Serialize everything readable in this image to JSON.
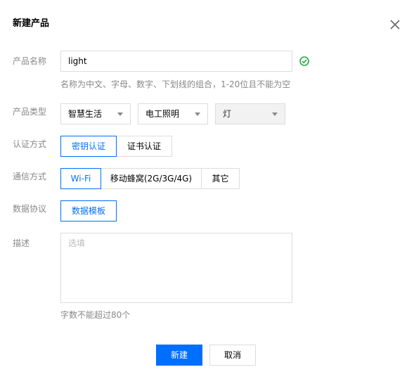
{
  "dialog": {
    "title": "新建产品",
    "close_icon": "close-icon"
  },
  "product_name": {
    "label": "产品名称",
    "value": "light",
    "status_icon": "check-circle-icon",
    "status_color": "#27a844",
    "hint": "名称为中文、字母、数字、下划线的组合，1-20位且不能为空"
  },
  "product_type": {
    "label": "产品类型",
    "selects": [
      "智慧生活",
      "电工照明",
      "灯"
    ]
  },
  "auth": {
    "label": "认证方式",
    "options": [
      "密钥认证",
      "证书认证"
    ],
    "selected": "密钥认证"
  },
  "comm": {
    "label": "通信方式",
    "options": [
      "Wi-Fi",
      "移动蜂窝(2G/3G/4G)",
      "其它"
    ],
    "selected": "Wi-Fi"
  },
  "protocol": {
    "label": "数据协议",
    "options": [
      "数据模板"
    ],
    "selected": "数据模板"
  },
  "description": {
    "label": "描述",
    "placeholder": "选填",
    "hint": "字数不能超过80个"
  },
  "footer": {
    "create": "新建",
    "cancel": "取消"
  },
  "colors": {
    "accent": "#006eff",
    "border": "#dddddd",
    "label": "#888888"
  }
}
